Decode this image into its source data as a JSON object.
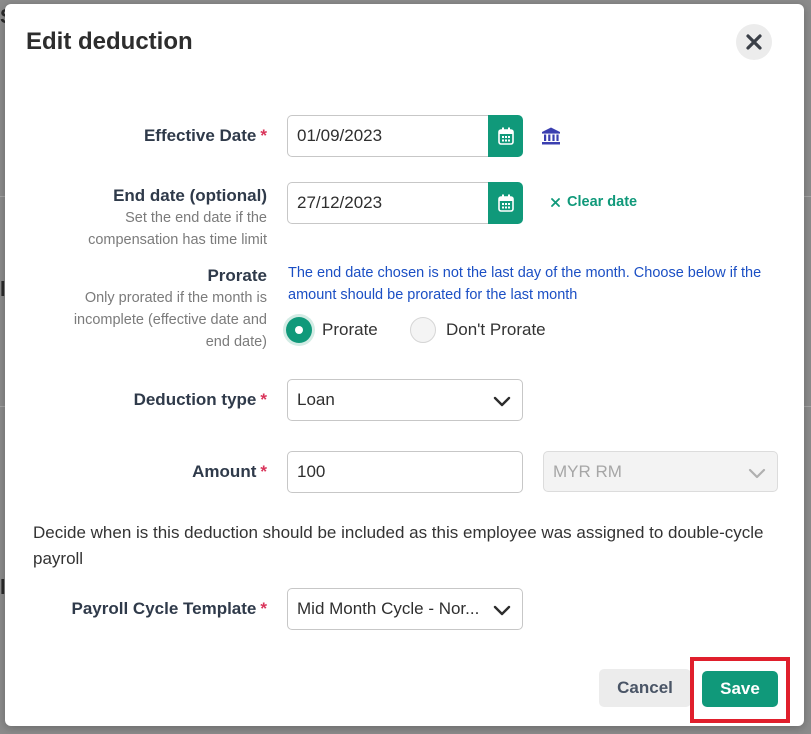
{
  "modal": {
    "title": "Edit deduction"
  },
  "effective_date": {
    "label": "Effective Date",
    "required_mark": "*",
    "value": "01/09/2023"
  },
  "end_date": {
    "label": "End date (optional)",
    "hint": "Set the end date if the compensation has time limit",
    "value": "27/12/2023",
    "clear_label": "Clear date"
  },
  "prorate": {
    "label": "Prorate",
    "hint": "Only prorated if the month is incomplete (effective date and end date)",
    "info": "The end date chosen is not the last day of the month. Choose below if the amount should be prorated for the last month",
    "options": [
      {
        "label": "Prorate",
        "selected": true
      },
      {
        "label": "Don't Prorate",
        "selected": false
      }
    ]
  },
  "deduction_type": {
    "label": "Deduction type",
    "required_mark": "*",
    "value": "Loan"
  },
  "amount": {
    "label": "Amount",
    "required_mark": "*",
    "value": "100",
    "currency": "MYR RM"
  },
  "payroll": {
    "description": "Decide when is this deduction should be included as this employee was assigned to double-cycle payroll",
    "label": "Payroll Cycle Template",
    "required_mark": "*",
    "value": "Mid Month Cycle - Nor..."
  },
  "footer": {
    "cancel_label": "Cancel",
    "save_label": "Save"
  },
  "colors": {
    "accent": "#10997a",
    "required": "#d9345a",
    "info": "#1b4fc4",
    "highlight": "#e01f2c"
  }
}
